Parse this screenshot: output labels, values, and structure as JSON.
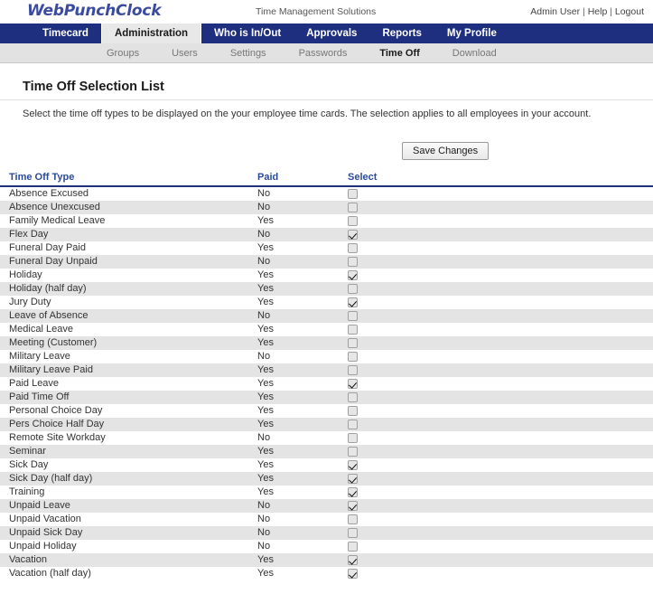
{
  "header": {
    "logo": "WebPunchClock",
    "tagline": "Time Management Solutions",
    "user": "Admin User",
    "help": "Help",
    "logout": "Logout",
    "sep": "|"
  },
  "main_nav": {
    "items": [
      {
        "label": "Timecard",
        "active": false
      },
      {
        "label": "Administration",
        "active": true
      },
      {
        "label": "Who is In/Out",
        "active": false
      },
      {
        "label": "Approvals",
        "active": false
      },
      {
        "label": "Reports",
        "active": false
      },
      {
        "label": "My Profile",
        "active": false
      }
    ]
  },
  "sub_nav": {
    "items": [
      {
        "label": "Groups",
        "active": false
      },
      {
        "label": "Users",
        "active": false
      },
      {
        "label": "Settings",
        "active": false
      },
      {
        "label": "Passwords",
        "active": false
      },
      {
        "label": "Time Off",
        "active": true
      },
      {
        "label": "Download",
        "active": false
      }
    ]
  },
  "page": {
    "title": "Time Off Selection List",
    "description": "Select the time off types to be displayed on the your employee time cards. The selection applies to all employees in your account.",
    "save_label": "Save Changes"
  },
  "table": {
    "headers": {
      "type": "Time Off Type",
      "paid": "Paid",
      "select": "Select"
    },
    "rows": [
      {
        "type": "Absence Excused",
        "paid": "No",
        "selected": false
      },
      {
        "type": "Absence Unexcused",
        "paid": "No",
        "selected": false
      },
      {
        "type": "Family Medical Leave",
        "paid": "Yes",
        "selected": false
      },
      {
        "type": "Flex Day",
        "paid": "No",
        "selected": true
      },
      {
        "type": "Funeral Day Paid",
        "paid": "Yes",
        "selected": false
      },
      {
        "type": "Funeral Day Unpaid",
        "paid": "No",
        "selected": false
      },
      {
        "type": "Holiday",
        "paid": "Yes",
        "selected": true
      },
      {
        "type": "Holiday (half day)",
        "paid": "Yes",
        "selected": false
      },
      {
        "type": "Jury Duty",
        "paid": "Yes",
        "selected": true
      },
      {
        "type": "Leave of Absence",
        "paid": "No",
        "selected": false
      },
      {
        "type": "Medical Leave",
        "paid": "Yes",
        "selected": false
      },
      {
        "type": "Meeting (Customer)",
        "paid": "Yes",
        "selected": false
      },
      {
        "type": "Military Leave",
        "paid": "No",
        "selected": false
      },
      {
        "type": "Military Leave Paid",
        "paid": "Yes",
        "selected": false
      },
      {
        "type": "Paid Leave",
        "paid": "Yes",
        "selected": true
      },
      {
        "type": "Paid Time Off",
        "paid": "Yes",
        "selected": false
      },
      {
        "type": "Personal Choice Day",
        "paid": "Yes",
        "selected": false
      },
      {
        "type": "Pers Choice Half Day",
        "paid": "Yes",
        "selected": false
      },
      {
        "type": "Remote Site Workday",
        "paid": "No",
        "selected": false
      },
      {
        "type": "Seminar",
        "paid": "Yes",
        "selected": false
      },
      {
        "type": "Sick Day",
        "paid": "Yes",
        "selected": true
      },
      {
        "type": "Sick Day (half day)",
        "paid": "Yes",
        "selected": true
      },
      {
        "type": "Training",
        "paid": "Yes",
        "selected": true
      },
      {
        "type": "Unpaid Leave",
        "paid": "No",
        "selected": true
      },
      {
        "type": "Unpaid Vacation",
        "paid": "No",
        "selected": false
      },
      {
        "type": "Unpaid Sick Day",
        "paid": "No",
        "selected": false
      },
      {
        "type": "Unpaid Holiday",
        "paid": "No",
        "selected": false
      },
      {
        "type": "Vacation",
        "paid": "Yes",
        "selected": true
      },
      {
        "type": "Vacation (half day)",
        "paid": "Yes",
        "selected": true
      }
    ]
  },
  "colors": {
    "brand_blue": "#1f2f7f",
    "logo_blue": "#3b4ba0",
    "header_text_blue": "#2a4a9a",
    "row_alt": "#e4e4e4",
    "subnav_bg": "#e2e2e2"
  }
}
